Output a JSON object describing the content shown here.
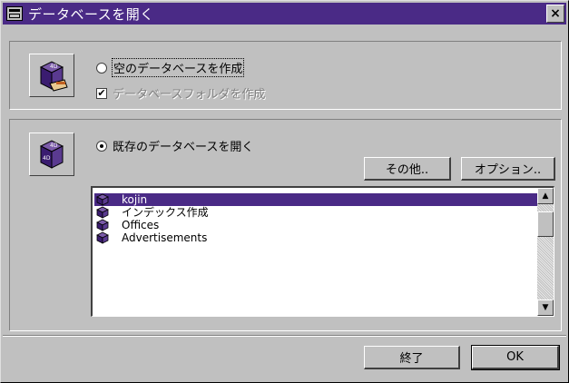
{
  "window": {
    "title": "データベースを開く",
    "close_label": "×"
  },
  "new_database": {
    "option_label": "空のデータベースを作成",
    "folder_checkbox_label": "データベースフォルダを作成",
    "folder_checkbox_checked": true,
    "folder_checkbox_mark": "✔"
  },
  "open_database": {
    "option_label": "既存のデータベースを開く",
    "other_button": "その他..",
    "options_button": "オプション..",
    "list": {
      "items": [
        {
          "label": "kojin",
          "selected": true
        },
        {
          "label": "インデックス作成",
          "selected": false
        },
        {
          "label": "Offices",
          "selected": false
        },
        {
          "label": "Advertisements",
          "selected": false
        }
      ],
      "scroll_up": "▲",
      "scroll_down": "▼"
    }
  },
  "footer": {
    "quit_button": "終了",
    "ok_button": "OK"
  },
  "colors": {
    "titlebar": "#4a2a86",
    "selection": "#4a2a86",
    "face": "#c0c0c0"
  }
}
